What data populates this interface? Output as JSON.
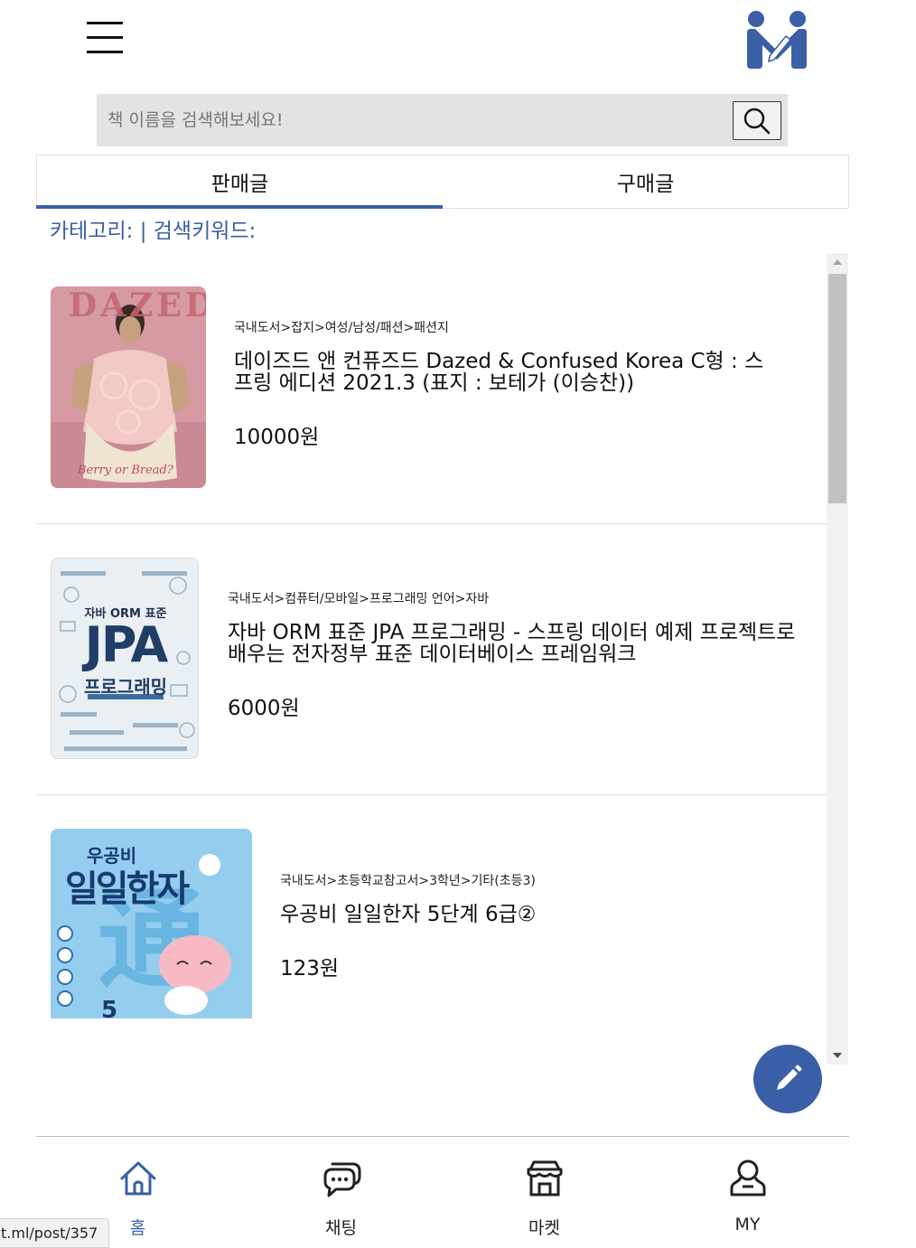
{
  "header": {
    "menu_icon": "hamburger-menu-icon",
    "logo_icon": "app-logo-icon"
  },
  "search": {
    "placeholder": "책 이름을 검색해보세요!",
    "button_icon": "search-icon"
  },
  "tabs": [
    {
      "label": "판매글",
      "active": true
    },
    {
      "label": "구매글",
      "active": false
    }
  ],
  "filter": {
    "text": "카테고리: | 검색키워드:"
  },
  "posts": [
    {
      "category": "국내도서>잡지>여성/남성/패션>패션지",
      "title": "데이즈드 앤 컨퓨즈드 Dazed & Confused Korea C형 : 스프링 에디션 2021.3 (표지 : 보테가 (이승찬))",
      "price": "10000원",
      "cover_text": "DAZED",
      "cover_subtext": "Berry or Bread?"
    },
    {
      "category": "국내도서>컴퓨터/모바일>프로그래밍 언어>자바",
      "title": "자바 ORM 표준 JPA 프로그래밍 - 스프링 데이터 예제 프로젝트로 배우는 전자정부 표준 데이터베이스 프레임워크",
      "price": "6000원",
      "cover_text_top": "자바 ORM 표준",
      "cover_text": "JPA",
      "cover_subtext": "프로그래밍"
    },
    {
      "category": "국내도서>초등학교참고서>3학년>기타(초등3)",
      "title": "우공비 일일한자 5단계 6급②",
      "price": "123원",
      "cover_text_top": "우공비",
      "cover_text": "일일한자",
      "cover_subtext": "通"
    }
  ],
  "fab": {
    "icon": "pencil-icon"
  },
  "bottom_nav": [
    {
      "label": "홈",
      "icon": "home-icon",
      "active": true
    },
    {
      "label": "채팅",
      "icon": "chat-icon",
      "active": false
    },
    {
      "label": "마켓",
      "icon": "store-icon",
      "active": false
    },
    {
      "label": "MY",
      "icon": "user-icon",
      "active": false
    }
  ],
  "status_bar": {
    "url": "t.ml/post/357"
  },
  "colors": {
    "accent": "#3a5fa6",
    "search_bg": "#e3e3e3",
    "scroll_track": "#f1f1f1"
  }
}
